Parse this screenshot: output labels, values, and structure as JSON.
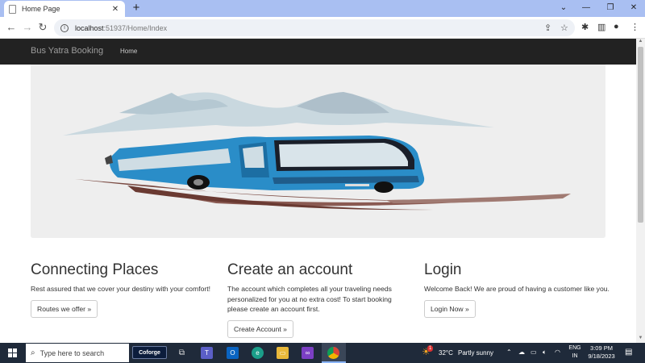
{
  "browser": {
    "tab_title": "Home Page",
    "tab_close": "✕",
    "new_tab": "+",
    "url_host": "localhost",
    "url_rest": ":51937/Home/Index",
    "win_minimize": "—",
    "win_restore": "❐",
    "win_close": "✕",
    "win_dropdown": "⌄"
  },
  "navbar": {
    "brand": "Bus Yatra Booking",
    "links": [
      "Home"
    ]
  },
  "columns": [
    {
      "heading": "Connecting Places",
      "text": "Rest assured that we cover your destiny with your comfort!",
      "button": "Routes we offer »"
    },
    {
      "heading": "Create an account",
      "text": "The account which completes all your traveling needs personalized for you at no extra cost! To start booking please create an account first.",
      "button": "Create Account »"
    },
    {
      "heading": "Login",
      "text": "Welcome Back! We are proud of having a customer like you.",
      "button": "Login Now »"
    }
  ],
  "taskbar": {
    "search_placeholder": "Type here to search",
    "pinned_label": "Coforge",
    "weather_temp": "32°C",
    "weather_text": "Partly sunny",
    "weather_badge": "1",
    "lang_top": "ENG",
    "lang_bottom": "IN",
    "time": "3:09 PM",
    "date": "9/18/2023"
  },
  "colors": {
    "navbar_bg": "#222222",
    "bus_blue": "#2a8dc8",
    "taskbar_bg": "#1f2a3a"
  }
}
